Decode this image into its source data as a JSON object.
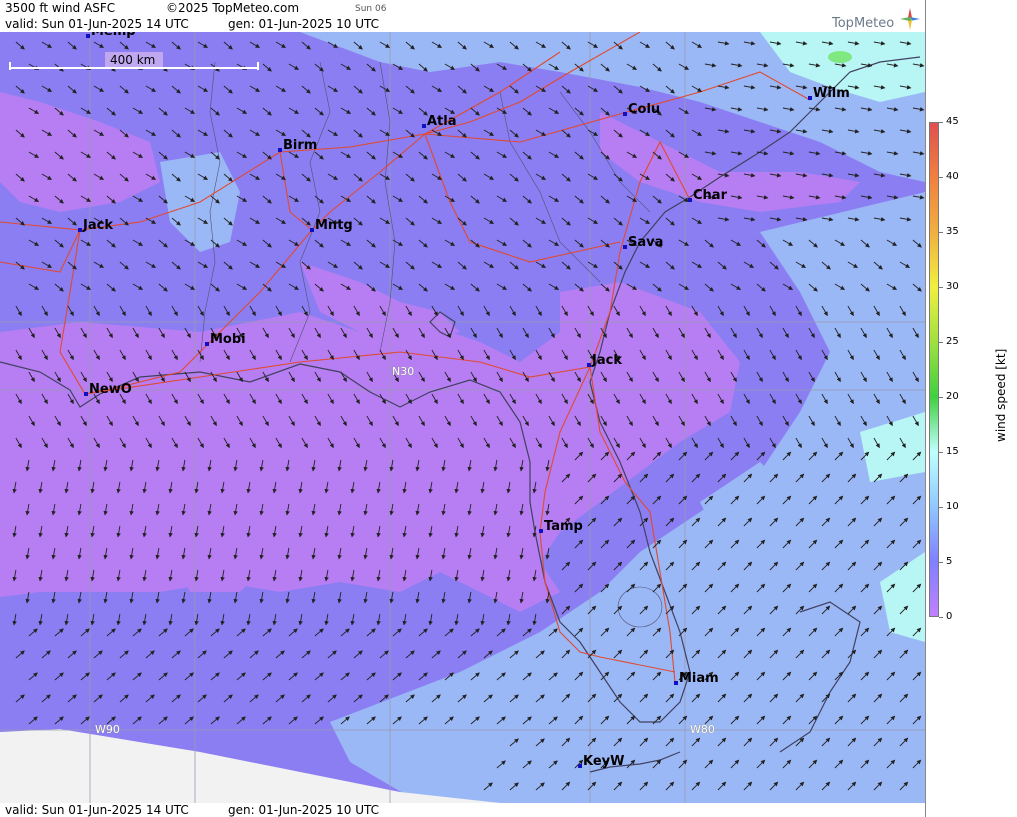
{
  "header": {
    "title": "3500 ft wind ASFC",
    "copyright": "©2025 TopMeteo.com",
    "day_tag": "Sun 06",
    "valid": "valid:  Sun  01-Jun-2025  14 UTC",
    "generated": "gen: 01-Jun-2025 10 UTC",
    "logo": "TopMeteo"
  },
  "footer": {
    "valid": "valid:  Sun  01-Jun-2025  14 UTC",
    "generated": "gen: 01-Jun-2025 10 UTC"
  },
  "map": {
    "scale_label": "400 km",
    "grid_labels": [
      "N30",
      "W90",
      "W80"
    ],
    "cities": [
      {
        "name": "Memp"
      },
      {
        "name": "Birm"
      },
      {
        "name": "Atla"
      },
      {
        "name": "Colu"
      },
      {
        "name": "Wilm"
      },
      {
        "name": "Jack"
      },
      {
        "name": "Mntg"
      },
      {
        "name": "Char"
      },
      {
        "name": "Sava"
      },
      {
        "name": "Mobi"
      },
      {
        "name": "Jack"
      },
      {
        "name": "NewO"
      },
      {
        "name": "Tamp"
      },
      {
        "name": "Miam"
      },
      {
        "name": "KeyW"
      }
    ]
  },
  "legend": {
    "label": "wind speed [kt]",
    "ticks": [
      "45",
      "40",
      "35",
      "30",
      "25",
      "20",
      "15",
      "10",
      "5",
      "0"
    ],
    "colors": [
      "#e05050",
      "#f08040",
      "#f0b040",
      "#f0f040",
      "#a0e040",
      "#40d040",
      "#c0ffff",
      "#90c8ff",
      "#8080ff",
      "#c080ff"
    ]
  },
  "colors": {
    "calm": "#b67ef2",
    "light": "#8c7ff2",
    "moderate": "#9bb8f6",
    "fresh": "#b8f5f5",
    "roads": "#e04a30",
    "coast": "#404060"
  }
}
